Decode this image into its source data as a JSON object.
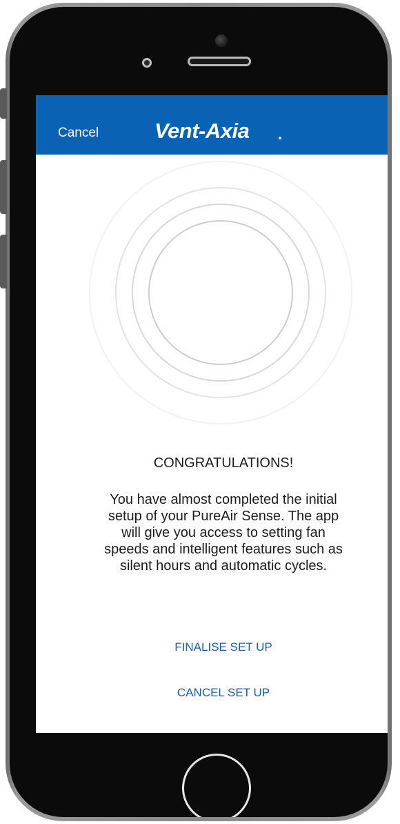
{
  "appbar": {
    "cancel_label": "Cancel",
    "logo_text": "Vent-Axia",
    "background_color": "#0a62b5"
  },
  "content": {
    "heading": "CONGRATULATIONS!",
    "body": "You have almost completed the initial setup of your PureAir Sense. The app will give you access to setting fan speeds and intelligent features such as silent hours and automatic cycles."
  },
  "actions": {
    "finalise_label": "FINALISE SET UP",
    "cancel_setup_label": "CANCEL SET UP",
    "link_color": "#1a5ea8"
  },
  "icons": {
    "rings": "concentric-rings-icon",
    "home": "home-button-icon"
  }
}
